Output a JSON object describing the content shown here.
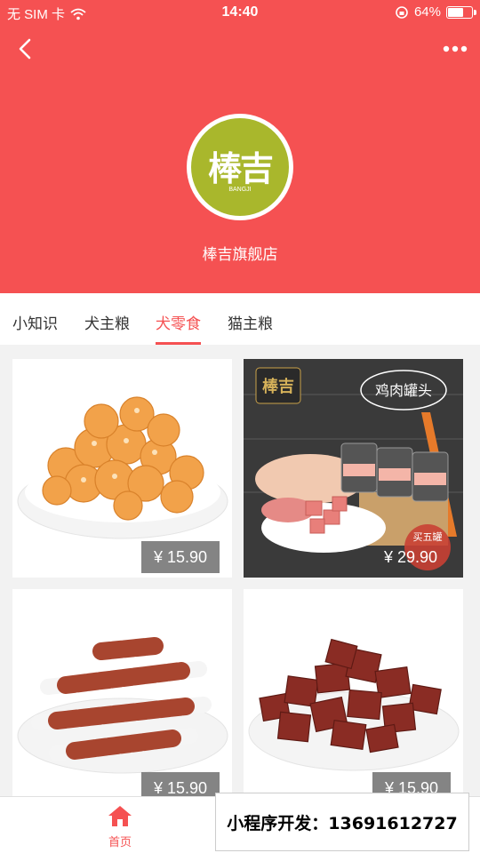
{
  "status_bar": {
    "carrier": "无 SIM 卡",
    "time": "14:40",
    "battery": "64%"
  },
  "store": {
    "logo_text": "棒吉",
    "logo_sub": "BANGJI",
    "name": "棒吉旗舰店"
  },
  "tabs": [
    {
      "label": "小知识"
    },
    {
      "label": "犬主粮"
    },
    {
      "label": "犬零食",
      "active": true
    },
    {
      "label": "猫主粮"
    }
  ],
  "products": [
    {
      "price": "¥ 15.90",
      "image": "popcorn-chicken-treats"
    },
    {
      "price": "¥ 29.90",
      "image": "chicken-can-treats",
      "overlay_text": "鸡肉罐头",
      "badge": "买五罐",
      "brand": "棒吉"
    },
    {
      "price": "¥ 15.90",
      "image": "chicken-wrapped-bones"
    },
    {
      "price": "¥ 15.90",
      "image": "jerky-cubes"
    }
  ],
  "bottom_nav": {
    "home_label": "首页"
  },
  "promo": "小程序开发：13691612727",
  "colors": {
    "primary": "#f55152",
    "logo_green": "#a9b72c"
  }
}
